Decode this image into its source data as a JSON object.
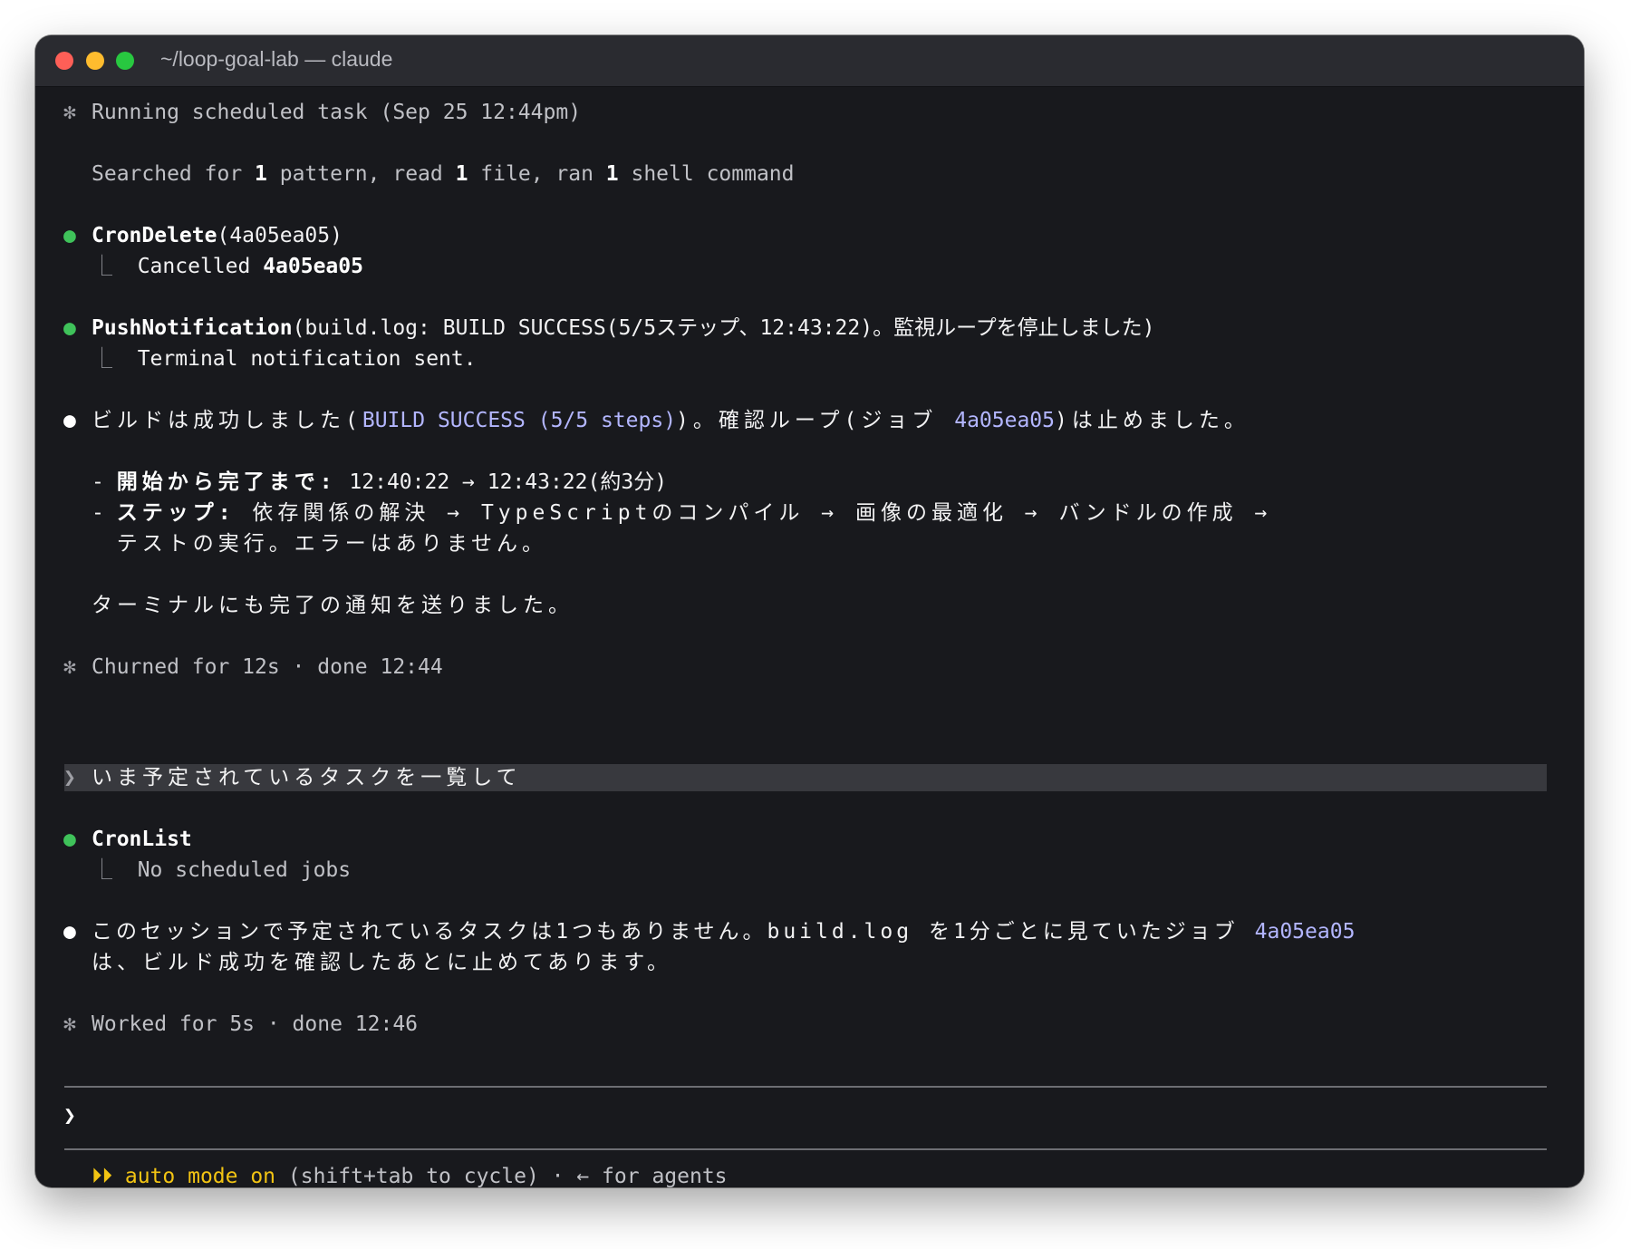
{
  "window": {
    "title": "~/loop-goal-lab — claude"
  },
  "transcript": {
    "running_header": {
      "bullet": "✻",
      "text": "Running scheduled task (Sep 25 12:44pm)"
    },
    "summary": {
      "a": "Searched for ",
      "n1": "1",
      "b": " pattern, read ",
      "n2": "1",
      "c": " file, ran ",
      "n3": "1",
      "d": " shell command"
    },
    "tool1": {
      "name": "CronDelete",
      "args": "(4a05ea05)",
      "result_prefix": "Cancelled ",
      "result_id": "4a05ea05"
    },
    "tool2": {
      "name": "PushNotification",
      "args": "(build.log: BUILD SUCCESS(5/5ステップ、12:43:22)。監視ループを停止しました)",
      "result": "Terminal notification sent."
    },
    "reply1": {
      "p1": "ビルドは成功しました(",
      "hl1": "BUILD SUCCESS (5/5 steps)",
      "p2": ")。確認ループ(ジョブ ",
      "hl2": "4a05ea05",
      "p3": ")は止めました。",
      "item1_label": "開始から完了まで:",
      "item1_text": " 12:40:22 → 12:43:22(約3分)",
      "item2_label": "ステップ:",
      "item2_text": " 依存関係の解決 → TypeScriptのコンパイル → 画像の最適化 → バンドルの作成 →",
      "item2_cont": "テストの実行。エラーはありません。",
      "closing": "ターミナルにも完了の通知を送りました。"
    },
    "status1": {
      "bullet": "✻",
      "text": "Churned for 12s · done 12:44"
    },
    "user_prompt": {
      "chevron": "❯",
      "text": "いま予定されているタスクを一覧して"
    },
    "tool3": {
      "name": "CronList",
      "result": "No scheduled jobs"
    },
    "reply2": {
      "p1": "このセッションで予定されているタスクは1つもありません。build.log を1分ごとに見ていたジョブ ",
      "hl": "4a05ea05",
      "p2": "は、ビルド成功を確認したあとに止めてあります。"
    },
    "status2": {
      "bullet": "✻",
      "text": "Worked for 5s · done 12:46"
    }
  },
  "input": {
    "chevron": "❯",
    "value": ""
  },
  "footer": {
    "mode_icon": "⏵⏵",
    "mode_label": "auto mode on",
    "hint": " (shift+tab to cycle) · ← for agents"
  },
  "colors": {
    "background": "#18191d",
    "accent": "#b3b6ff",
    "success_dot": "#3fc25a",
    "mode": "#f2c413"
  }
}
